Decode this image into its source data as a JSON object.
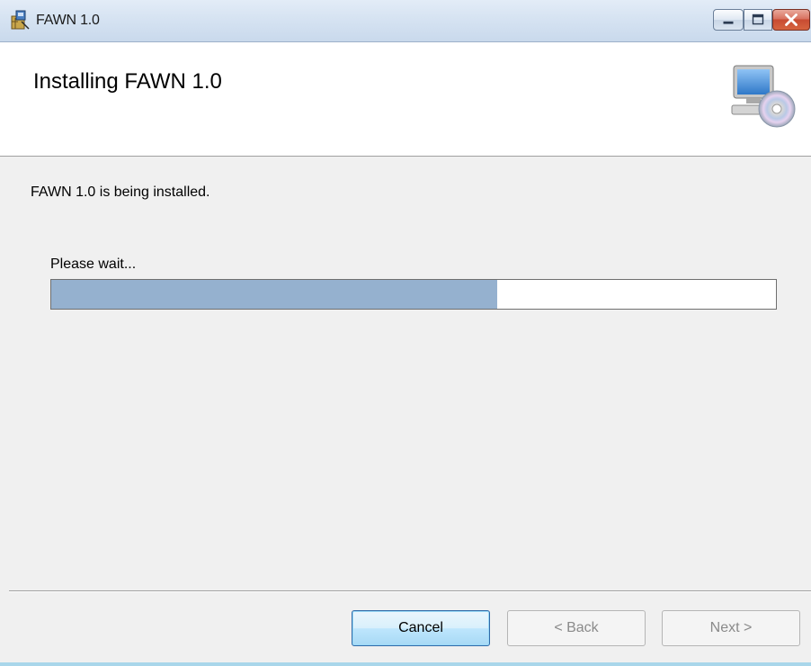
{
  "window": {
    "title": "FAWN 1.0"
  },
  "header": {
    "title": "Installing FAWN 1.0",
    "icon": "computer-with-disc-icon"
  },
  "body": {
    "status_text": "FAWN 1.0 is being installed.",
    "wait_label": "Please wait...",
    "progress_fraction": 0.615
  },
  "buttons": {
    "cancel_label": "Cancel",
    "back_label": "< Back",
    "next_label": "Next >"
  },
  "colors": {
    "progress_fill": "#95b1cf",
    "title_bar": "#d6e3f2",
    "close_button": "#c84b32"
  }
}
